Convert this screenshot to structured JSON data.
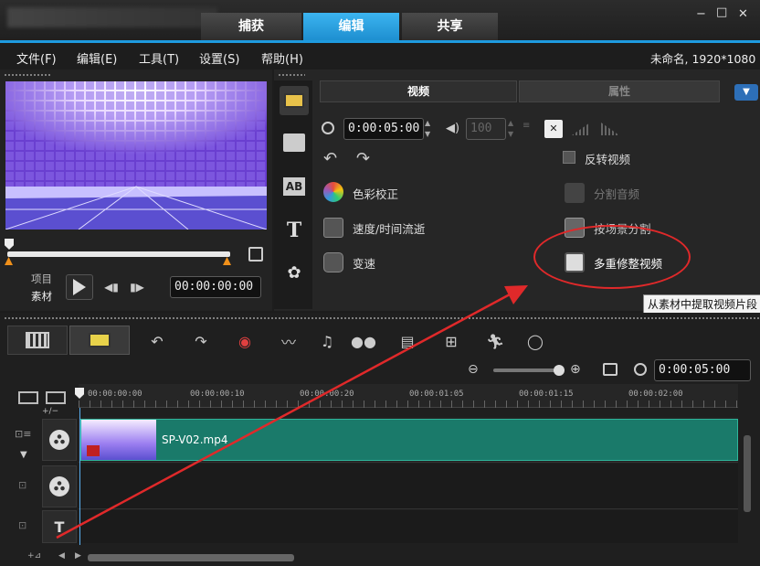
{
  "tabs": [
    {
      "label": "捕获"
    },
    {
      "label": "编辑"
    },
    {
      "label": "共享"
    }
  ],
  "window_controls": {
    "minimize": "−",
    "maximize": "□",
    "close": "✕"
  },
  "menu": [
    "文件(F)",
    "编辑(E)",
    "工具(T)",
    "设置(S)",
    "帮助(H)"
  ],
  "project_info": "未命名, 1920*1080",
  "preview": {
    "project_label": "项目",
    "clip_label": "素材",
    "timecode": "00:00:00:00"
  },
  "options_panel": {
    "tabs": [
      "视频",
      "属性"
    ],
    "duration": "0:00:05:00",
    "volume": "100",
    "items_left": [
      "色彩校正",
      "速度/时间流逝",
      "变速"
    ],
    "reverse_video": "反转视频",
    "items_right": [
      "分割音频",
      "按场景分割",
      "多重修整视频"
    ],
    "tooltip": "从素材中提取视频片段"
  },
  "timeline": {
    "duration": "0:00:05:00",
    "ruler": [
      "00:00:00:00",
      "00:00:00:10",
      "00:00:00:20",
      "00:00:01:05",
      "00:00:01:15",
      "00:00:02:00"
    ],
    "clip_name": "SP-V02.mp4",
    "add_label": "+/−"
  },
  "colors": {
    "accent": "#1e9be0",
    "clip": "#1a7a6a",
    "annotation": "#e0292a"
  }
}
